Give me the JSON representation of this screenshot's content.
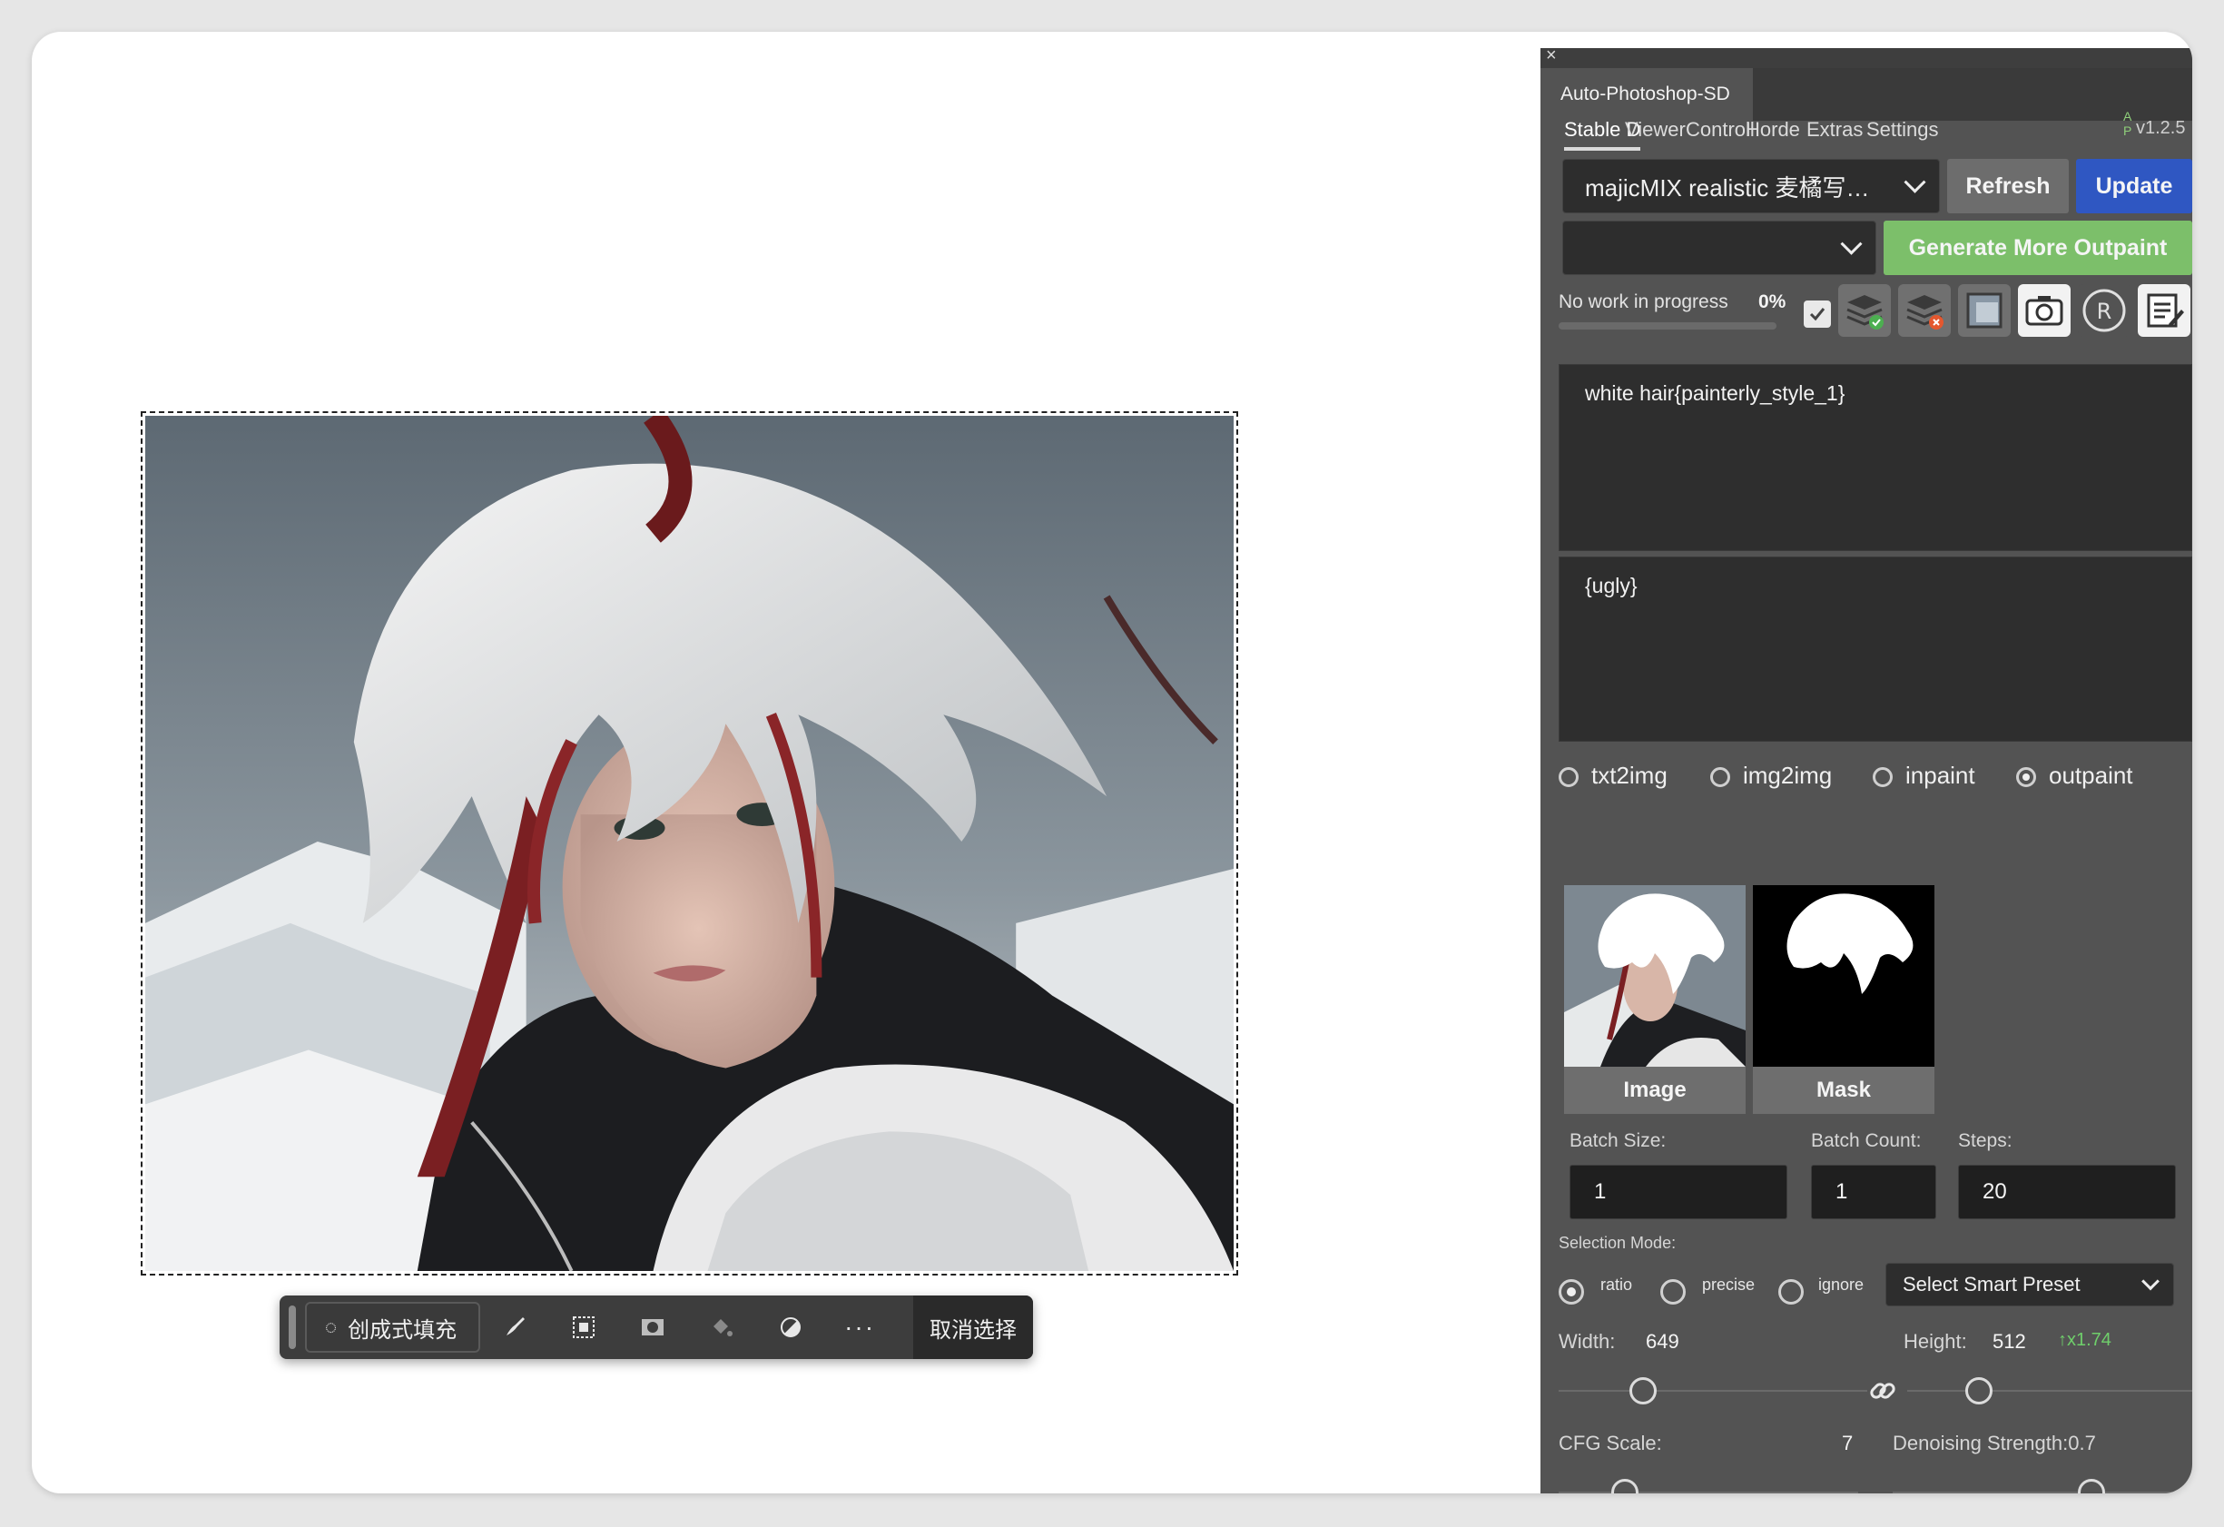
{
  "toolbar": {
    "generative_fill_label": "创成式填充",
    "cancel_selection_label": "取消选择"
  },
  "panel": {
    "title": "Auto-Photoshop-SD",
    "tabs": [
      "Stable D",
      "Viewer",
      "Controll",
      "Horde",
      "Extras",
      "Settings"
    ],
    "version": "v1.2.5",
    "version_badge": "A P",
    "model_select": "majicMIX realistic 麦橘写…",
    "refresh_label": "Refresh",
    "update_label": "Update",
    "secondary_select": "",
    "generate_label": "Generate More Outpaint",
    "status_text": "No work in progress",
    "progress_percent": "0%",
    "progress_value": 0,
    "prompt": "white hair{painterly_style_1}",
    "negative_prompt": "{ugly}",
    "modes": [
      "txt2img",
      "img2img",
      "inpaint",
      "outpaint"
    ],
    "selected_mode": "outpaint",
    "image_label": "Image",
    "mask_label": "Mask",
    "batch_size_label": "Batch Size:",
    "batch_size": "1",
    "batch_count_label": "Batch Count:",
    "batch_count": "1",
    "steps_label": "Steps:",
    "steps": "20",
    "selection_mode_label": "Selection Mode:",
    "selection_modes": [
      "ratio",
      "precise",
      "ignore"
    ],
    "selected_selection_mode": "ratio",
    "smart_preset": "Select Smart Preset",
    "width_label": "Width:",
    "width": "649",
    "height_label": "Height:",
    "height": "512",
    "scale_ratio": "↑x1.74",
    "cfg_label": "CFG Scale:",
    "cfg": "7",
    "denoise_label": "Denoising Strength:0.7"
  },
  "colors": {
    "generate_green": "#7cbf6a",
    "update_blue": "#2f57c2",
    "refresh_gray": "#6d6d6d",
    "panel_bg": "#535353",
    "ratio_green": "#6fcf6b"
  }
}
